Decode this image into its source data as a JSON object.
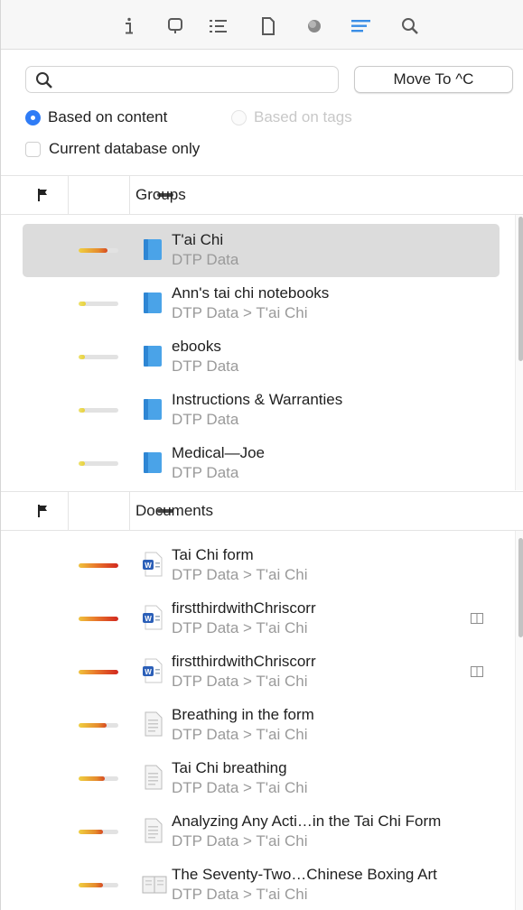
{
  "toolbar": {
    "icons": [
      "info-icon",
      "annotation-icon",
      "list-icon",
      "document-icon",
      "tags-icon",
      "see-also-icon",
      "search-icon"
    ],
    "active_color": "#3a8ee6"
  },
  "search": {
    "value": "",
    "placeholder": ""
  },
  "move_button": {
    "label": "Move To ^C"
  },
  "options": {
    "based_on_content": "Based on content",
    "based_on_tags": "Based on tags",
    "current_db_only": "Current database only"
  },
  "groups_section": {
    "header": "Groups",
    "items": [
      {
        "title": "T'ai Chi",
        "path": "DTP Data",
        "score": 0.72,
        "selected": true,
        "icon": "group-folder-icon"
      },
      {
        "title": "Ann's tai chi notebooks",
        "path": "DTP Data > T'ai Chi",
        "score": 0.18,
        "icon": "group-folder-icon"
      },
      {
        "title": "ebooks",
        "path": "DTP Data",
        "score": 0.16,
        "icon": "group-folder-icon"
      },
      {
        "title": "Instructions & Warranties",
        "path": "DTP Data",
        "score": 0.16,
        "icon": "group-folder-icon"
      },
      {
        "title": "Medical—Joe",
        "path": "DTP Data",
        "score": 0.16,
        "icon": "group-folder-icon"
      }
    ]
  },
  "documents_section": {
    "header": "Documents",
    "items": [
      {
        "title": "Tai Chi form",
        "path": "DTP Data > T'ai Chi",
        "score": 1.0,
        "icon": "word-document-icon",
        "side_icon": false
      },
      {
        "title": "firstthirdwithChriscorr",
        "path": "DTP Data > T'ai Chi",
        "score": 1.0,
        "icon": "word-document-icon",
        "side_icon": true
      },
      {
        "title": "firstthirdwithChriscorr",
        "path": "DTP Data > T'ai Chi",
        "score": 1.0,
        "icon": "word-document-icon",
        "side_icon": true
      },
      {
        "title": "Breathing in the form",
        "path": "DTP Data > T'ai Chi",
        "score": 0.7,
        "icon": "text-document-icon",
        "side_icon": false
      },
      {
        "title": "Tai Chi breathing",
        "path": "DTP Data > T'ai Chi",
        "score": 0.66,
        "icon": "text-document-icon",
        "side_icon": false
      },
      {
        "title": "Analyzing Any Acti…in the Tai Chi Form",
        "path": "DTP Data > T'ai Chi",
        "score": 0.62,
        "icon": "text-document-icon",
        "side_icon": false
      },
      {
        "title": "The Seventy-Two…Chinese Boxing Art",
        "path": "DTP Data > T'ai Chi",
        "score": 0.62,
        "icon": "book-document-icon",
        "side_icon": false
      }
    ]
  }
}
